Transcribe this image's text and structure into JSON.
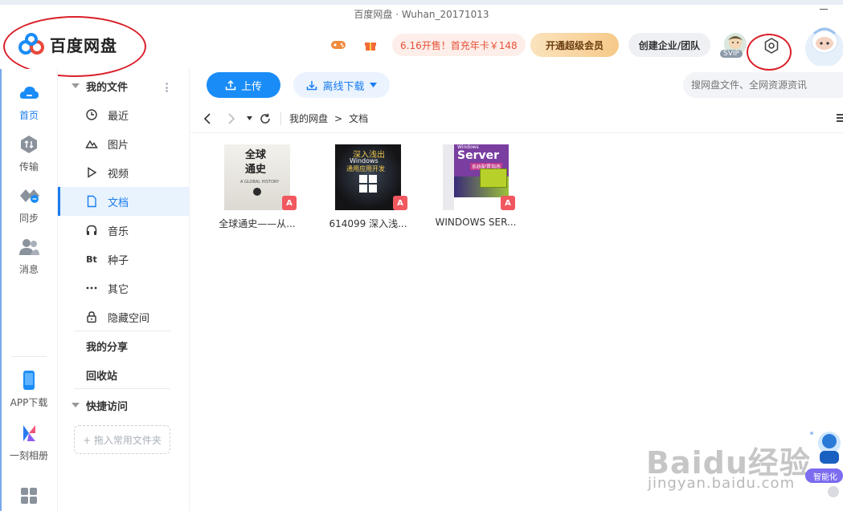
{
  "window": {
    "title": "百度网盘 · Wuhan_20171013"
  },
  "brand": {
    "name": "百度网盘",
    "accent": "#1a8cf7",
    "annotation_color": "#d9202a"
  },
  "header": {
    "promo_text": "6.16开售！首充年卡￥148",
    "vip_button": "开通超级会员",
    "team_button": "创建企业/团队",
    "svip_badge": "SVIP",
    "icons": [
      "gamepad-icon",
      "gift-icon",
      "gear-icon"
    ]
  },
  "rail": {
    "items": [
      {
        "label": "首页",
        "icon": "cloud-home-icon",
        "active": true
      },
      {
        "label": "传输",
        "icon": "transfer-icon",
        "active": false
      },
      {
        "label": "同步",
        "icon": "sync-icon",
        "active": false
      },
      {
        "label": "消息",
        "icon": "message-icon",
        "active": false
      }
    ],
    "bottom": [
      {
        "label": "APP下载",
        "icon": "phone-icon"
      },
      {
        "label": "一刻相册",
        "icon": "album-icon"
      }
    ]
  },
  "tree": {
    "my_files": "我的文件",
    "items": [
      {
        "label": "最近",
        "icon": "clock-icon"
      },
      {
        "label": "图片",
        "icon": "mountain-icon"
      },
      {
        "label": "视频",
        "icon": "play-icon"
      },
      {
        "label": "文档",
        "icon": "document-icon",
        "active": true
      },
      {
        "label": "音乐",
        "icon": "headphones-icon"
      },
      {
        "label": "种子",
        "icon": "bt-icon"
      },
      {
        "label": "其它",
        "icon": "more-icon"
      },
      {
        "label": "隐藏空间",
        "icon": "lock-icon"
      }
    ],
    "bt_glyph": "Bt",
    "my_share": "我的分享",
    "recycle": "回收站",
    "quick_access": "快捷访问",
    "drop_hint": "+ 拖入常用文件夹"
  },
  "toolbar": {
    "upload": "上传",
    "offline_download": "离线下载",
    "search_placeholder": "搜网盘文件、全网资源资讯"
  },
  "breadcrumb": {
    "root": "我的网盘",
    "sep": ">",
    "current": "文档"
  },
  "files": [
    {
      "name": "全球通史——从...",
      "cover_title_1": "全球",
      "cover_title_2": "通史",
      "cover_sub": "A GLOBAL HISTORY",
      "type": "pdf"
    },
    {
      "name": "614099 深入浅...",
      "cover_title_1": "深入浅出",
      "cover_title_2": "Windows",
      "cover_sub": "通用应用开发",
      "type": "pdf"
    },
    {
      "name": "WINDOWS SER...",
      "cover_title_1": "Windows",
      "cover_title_2": "Server",
      "cover_sub": "系统配置指南",
      "type": "pdf"
    }
  ],
  "watermark": {
    "big": "Baidu经验",
    "url": "jingyan.baidu.com"
  },
  "ai_widget": {
    "label": "智能化"
  }
}
